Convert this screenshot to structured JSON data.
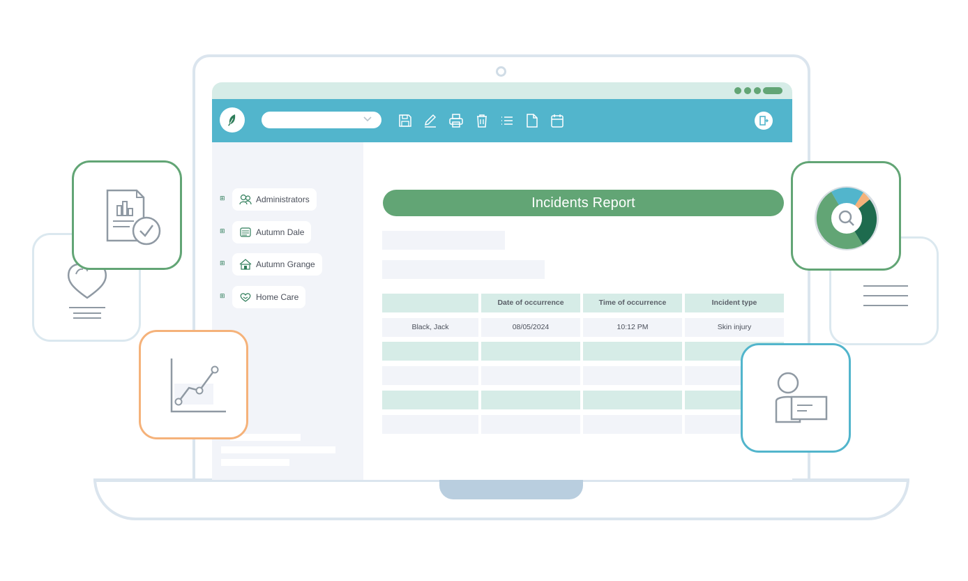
{
  "app": {
    "selector_value": "",
    "toolbar_tools": [
      "save-icon",
      "edit-icon",
      "print-icon",
      "trash-icon",
      "list-icon",
      "document-icon",
      "calendar-icon"
    ],
    "exit_icon": "logout-icon"
  },
  "sidebar": {
    "items": [
      {
        "label": "Administrators",
        "icon": "people-icon",
        "expand": "⊞"
      },
      {
        "label": "Autumn Dale",
        "icon": "building-icon",
        "expand": "⊞"
      },
      {
        "label": "Autumn Grange",
        "icon": "house-icon",
        "expand": "⊞"
      },
      {
        "label": "Home Care",
        "icon": "heart-hands-icon",
        "expand": "⊞"
      }
    ]
  },
  "report": {
    "title": "Incidents Report",
    "columns": [
      "",
      "Date of occurrence",
      "Time of occurrence",
      "Incident type"
    ],
    "rows": [
      [
        "Black, Jack",
        "08/05/2024",
        "10:12 PM",
        "Skin injury"
      ]
    ]
  },
  "colors": {
    "accent_green": "#62a575",
    "toolbar_blue": "#52b5cc",
    "light_green": "#d6ece7",
    "orange": "#f5b27a"
  },
  "decor_cards": [
    "report-check-icon",
    "heart-icon",
    "line-chart-icon",
    "donut-search-icon",
    "lines-icon",
    "user-card-icon"
  ]
}
